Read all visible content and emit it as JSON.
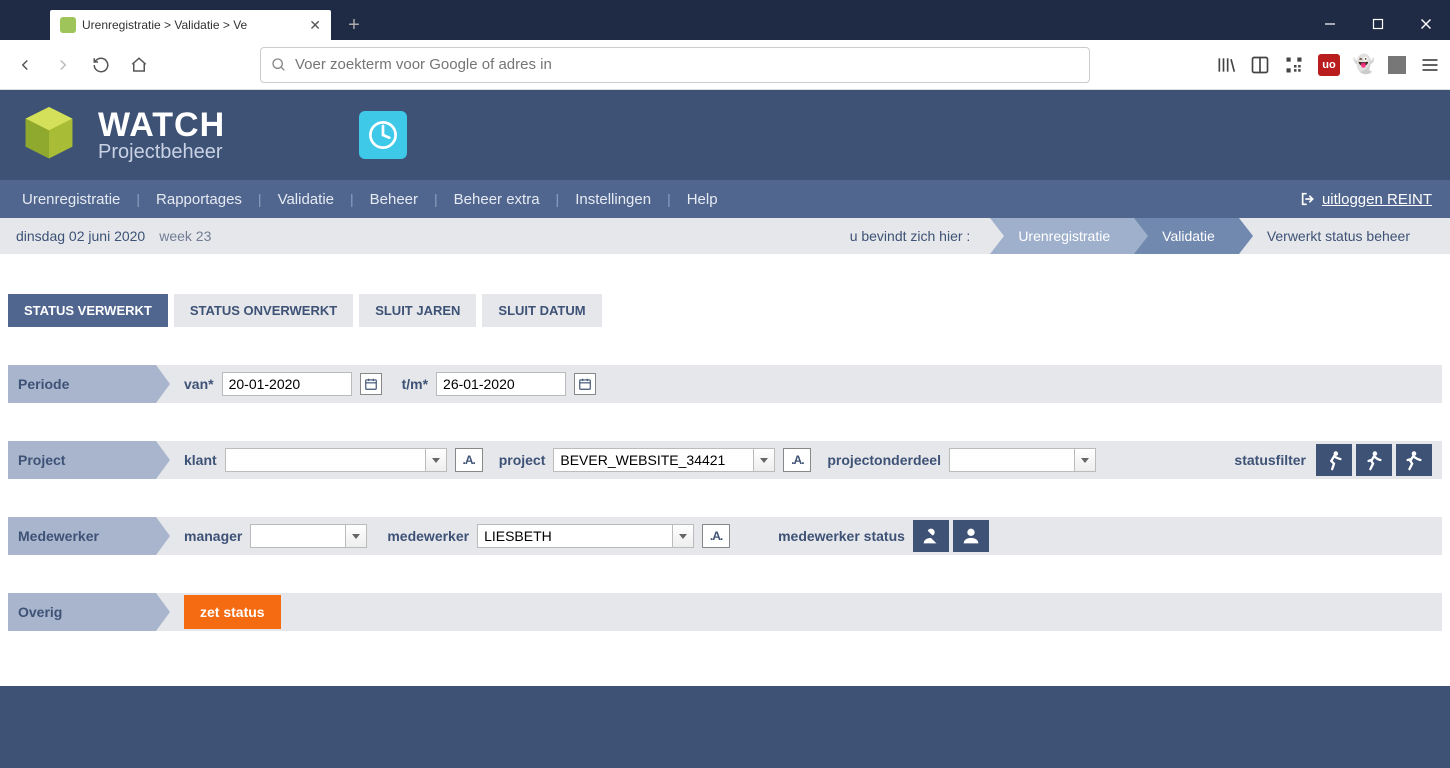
{
  "browser": {
    "tab_title": "Urenregistratie > Validatie > Ve",
    "url_placeholder": "Voer zoekterm voor Google of adres in"
  },
  "header": {
    "brand": "WATCH",
    "subtitle": "Projectbeheer"
  },
  "nav": {
    "items": [
      "Urenregistratie",
      "Rapportages",
      "Validatie",
      "Beheer",
      "Beheer extra",
      "Instellingen",
      "Help"
    ],
    "logout_label": "uitloggen REINT"
  },
  "crumb": {
    "date": "dinsdag 02 juni 2020",
    "week": "week 23",
    "loc_label": "u bevindt zich hier :",
    "path": [
      "Urenregistratie",
      "Validatie",
      "Verwerkt status beheer"
    ]
  },
  "tabs": [
    "STATUS VERWERKT",
    "STATUS ONVERWERKT",
    "SLUIT JAREN",
    "SLUIT DATUM"
  ],
  "periode": {
    "label": "Periode",
    "van_label": "van*",
    "van_value": "20-01-2020",
    "tm_label": "t/m*",
    "tm_value": "26-01-2020"
  },
  "project": {
    "label": "Project",
    "klant_label": "klant",
    "klant_value": "",
    "project_label": "project",
    "project_value": "BEVER_WEBSITE_34421",
    "onderdeel_label": "projectonderdeel",
    "onderdeel_value": "",
    "statusfilter_label": "statusfilter"
  },
  "medewerker": {
    "label": "Medewerker",
    "manager_label": "manager",
    "manager_value": "",
    "medewerker_label": "medewerker",
    "medewerker_value": "LIESBETH",
    "status_label": "medewerker status"
  },
  "overig": {
    "label": "Overig",
    "button": "zet status"
  }
}
